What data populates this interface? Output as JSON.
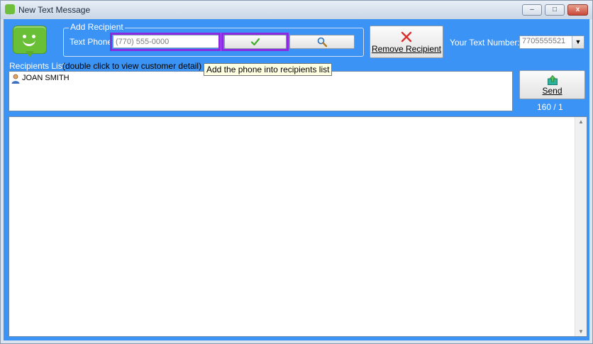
{
  "window": {
    "title": "New Text Message",
    "minimize_label": "–",
    "maximize_label": "□",
    "close_label": "x"
  },
  "add_recipient": {
    "group_label": "Add Recipient",
    "text_phone_label": "Text Phone",
    "phone_value": "(770) 555-0000",
    "add_button_icon": "check-icon",
    "search_button_icon": "search-icon",
    "add_tooltip": "Add the phone into recipients list"
  },
  "remove_recipient": {
    "label": "Remove Recipient",
    "icon": "x-icon"
  },
  "text_number": {
    "label": "Your Text Number:",
    "value": "7705555521"
  },
  "recipients": {
    "label": "Recipients List",
    "hint": "(double click to view customer detail)",
    "items": [
      {
        "name": "JOAN SMITH",
        "icon": "person-icon"
      }
    ]
  },
  "send": {
    "label": "Send",
    "icon": "upload-icon",
    "char_count": "160 / 1"
  },
  "message": {
    "text": ""
  },
  "colors": {
    "accent": "#3b93f5",
    "highlight": "#8a2be2",
    "logo_green": "#69bf35",
    "remove_red": "#d9302c",
    "check_green": "#3fae2a"
  }
}
